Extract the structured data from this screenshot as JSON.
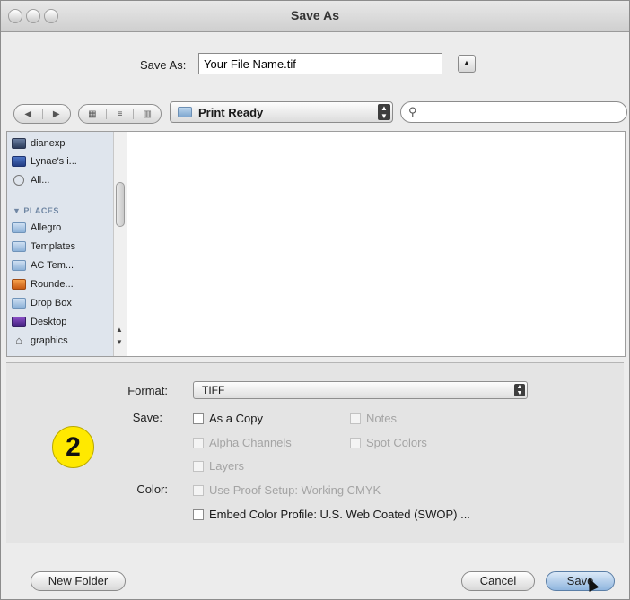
{
  "window": {
    "title": "Save As"
  },
  "save_as": {
    "label": "Save As:",
    "filename": "Your File Name.tif"
  },
  "nav": {
    "location": "Print Ready",
    "search_value": ""
  },
  "sidebar": {
    "devices": [
      {
        "label": "dianexp",
        "icon": "computer-icon"
      },
      {
        "label": "Lynae's i...",
        "icon": "computer-icon"
      },
      {
        "label": "All...",
        "icon": "network-icon"
      }
    ],
    "places_header": "PLACES",
    "places": [
      {
        "label": "Allegro",
        "icon": "folder-icon"
      },
      {
        "label": "Templates",
        "icon": "folder-icon"
      },
      {
        "label": "AC Tem...",
        "icon": "folder-icon"
      },
      {
        "label": "Rounde...",
        "icon": "application-icon"
      },
      {
        "label": "Drop Box",
        "icon": "folder-icon"
      },
      {
        "label": "Desktop",
        "icon": "desktop-icon"
      },
      {
        "label": "graphics",
        "icon": "home-icon"
      }
    ]
  },
  "options": {
    "format_label": "Format:",
    "format_value": "TIFF",
    "save_label": "Save:",
    "as_a_copy": "As a Copy",
    "notes": "Notes",
    "alpha_channels": "Alpha Channels",
    "spot_colors": "Spot Colors",
    "layers": "Layers",
    "color_label": "Color:",
    "use_proof_setup": "Use Proof Setup: Working CMYK",
    "embed_color_profile": "Embed Color Profile: U.S. Web Coated (SWOP) ..."
  },
  "step_badge": "2",
  "buttons": {
    "new_folder": "New Folder",
    "cancel": "Cancel",
    "save": "Save"
  },
  "colors": {
    "badge": "#ffe900",
    "sidebar_bg": "#dfe5ed",
    "default_button": "#8fb5de"
  }
}
